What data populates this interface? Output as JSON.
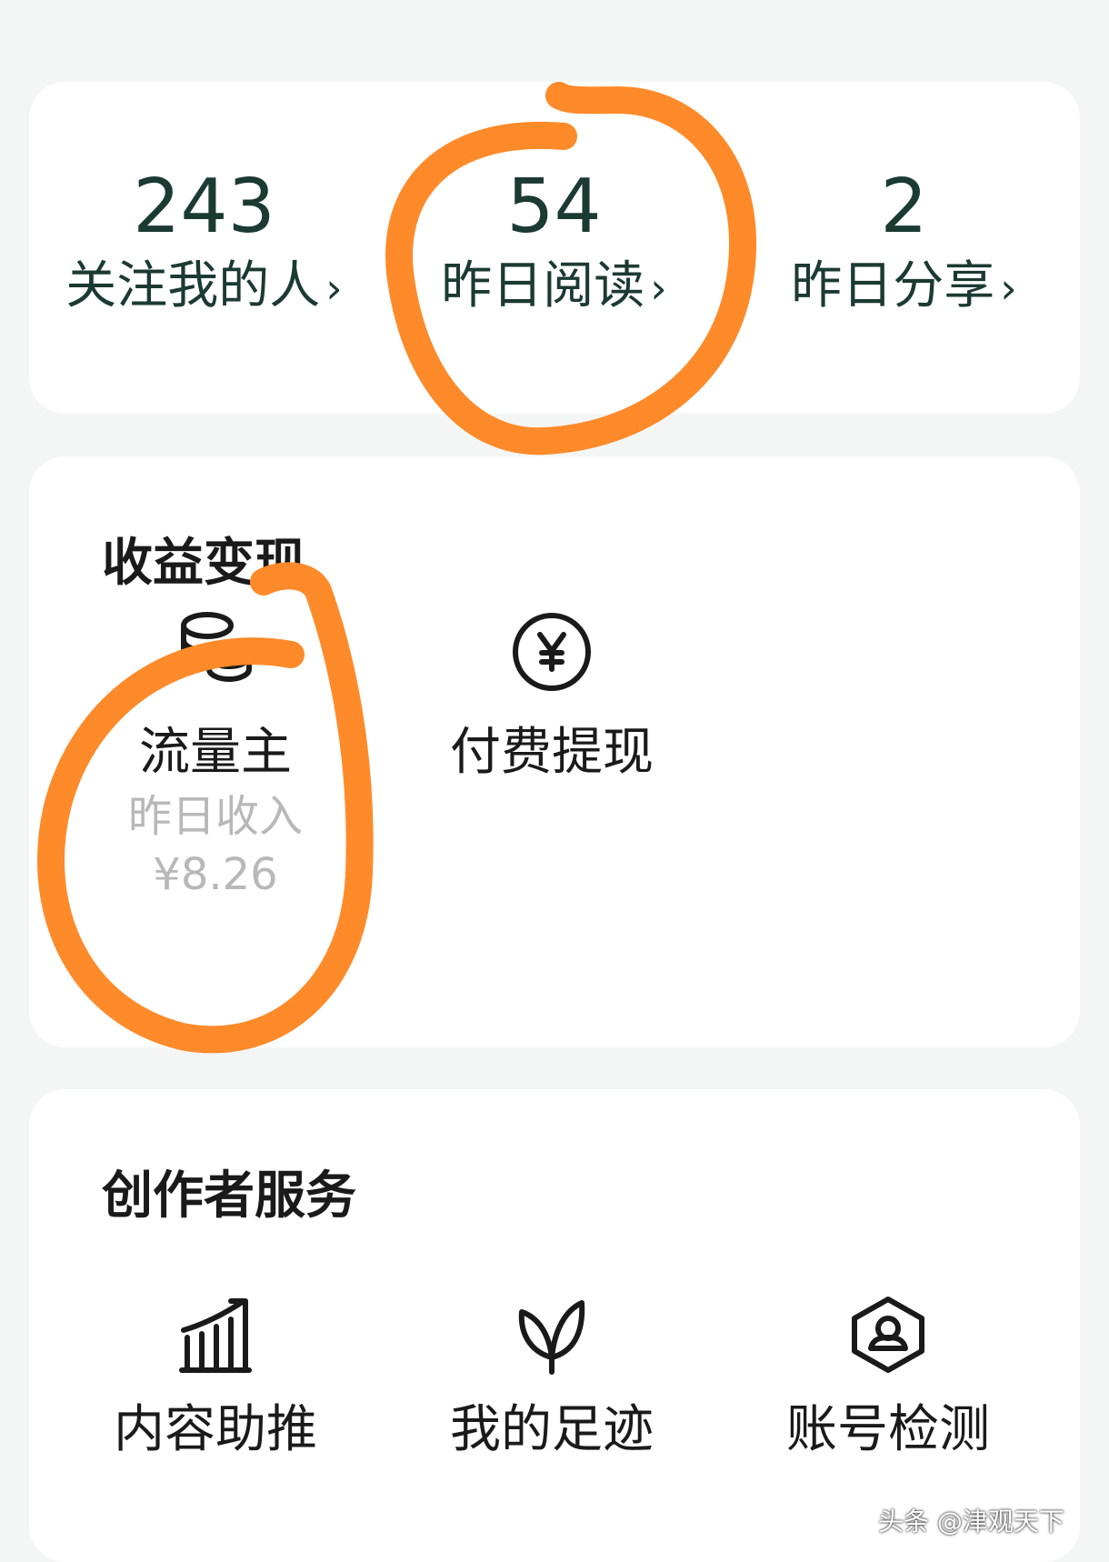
{
  "stats": [
    {
      "value": "243",
      "label": "关注我的人"
    },
    {
      "value": "54",
      "label": "昨日阅读"
    },
    {
      "value": "2",
      "label": "昨日分享"
    }
  ],
  "income": {
    "title": "收益变现",
    "items": [
      {
        "icon": "coins-icon",
        "label": "流量主",
        "sublabel": "昨日收入",
        "amount": "¥8.26"
      },
      {
        "icon": "yen-circle-icon",
        "label": "付费提现"
      }
    ]
  },
  "services": {
    "title": "创作者服务",
    "items": [
      {
        "icon": "growth-chart-icon",
        "label": "内容助推"
      },
      {
        "icon": "sprout-icon",
        "label": "我的足迹"
      },
      {
        "icon": "account-shield-icon",
        "label": "账号检测"
      }
    ]
  },
  "watermark": "头条 @津观天下",
  "colors": {
    "background": "#f4f6f6",
    "card": "#ffffff",
    "stat_text": "#1b3a32",
    "muted_text": "#b8b8b8",
    "annotation": "#ff8a2a"
  }
}
